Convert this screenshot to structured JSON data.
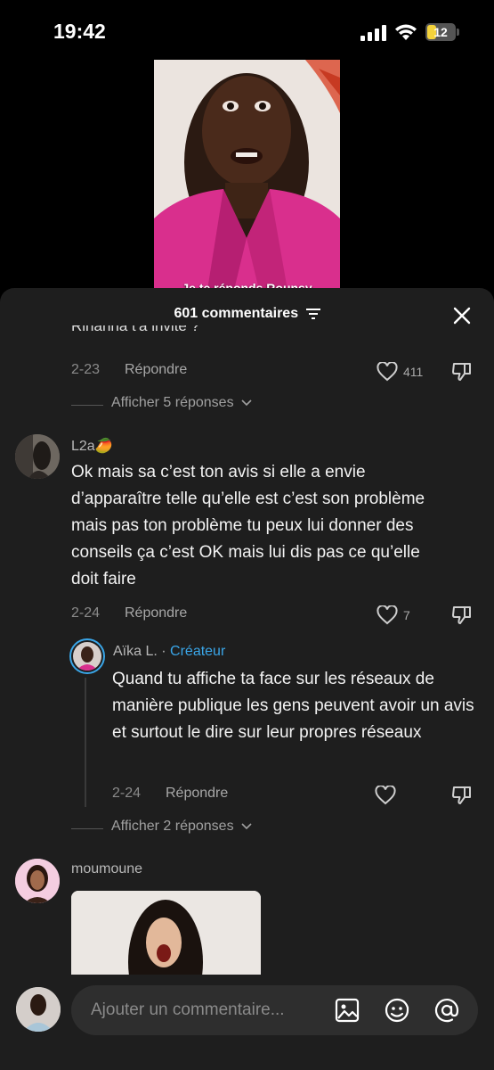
{
  "status_bar": {
    "time": "19:42",
    "battery": "12"
  },
  "video": {
    "caption": "Je te réponds Rounsy"
  },
  "sheet": {
    "title": "601 commentaires"
  },
  "comments": [
    {
      "cut_text": "Rihanna t'a invité ?",
      "date": "2-23",
      "reply_label": "Répondre",
      "likes": "411",
      "view_replies": "Afficher 5 réponses"
    },
    {
      "username": "L2a🥭",
      "text": "Ok mais sa c’est ton avis si elle a envie d’apparaître telle qu’elle est c’est son problème mais pas ton problème tu peux lui donner des conseils ça c’est OK mais lui dis pas ce qu’elle doit faire",
      "date": "2-24",
      "reply_label": "Répondre",
      "likes": "7",
      "reply": {
        "username": "Aïka L.",
        "separator": " · ",
        "badge": "Créateur",
        "text": "Quand tu affiche ta face sur les réseaux de manière publique les gens peuvent avoir un avis et surtout le dire sur leur propres réseaux",
        "date": "2-24",
        "reply_label": "Répondre"
      },
      "view_replies": "Afficher 2 réponses"
    },
    {
      "username": "moumoune"
    }
  ],
  "composer": {
    "placeholder": "Ajouter un commentaire..."
  }
}
